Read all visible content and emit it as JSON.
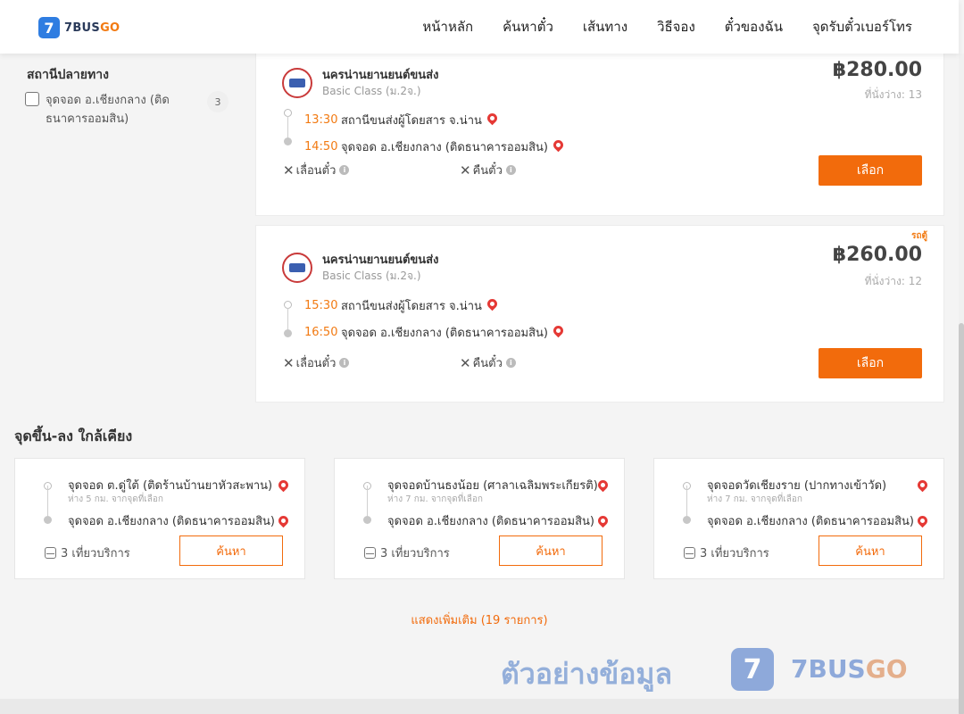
{
  "header": {
    "logo_mark": "7",
    "logo_text_main": "7BUS",
    "logo_text_accent": "GO",
    "nav": [
      "หน้าหลัก",
      "ค้นหาตั๋ว",
      "เส้นทาง",
      "วิธีจอง",
      "ตั๋วของฉัน",
      "จุดรับตั๋วเบอร์โทร"
    ]
  },
  "filter": {
    "title": "สถานีปลายทาง",
    "options": [
      {
        "label": "จุดจอด อ.เชียงกลาง (ติดธนาคารออมสิน)",
        "count": "3",
        "checked": false
      }
    ]
  },
  "trips": [
    {
      "operator": "นครน่านยานยนต์ขนส่ง",
      "class": "Basic Class (ม.2จ.)",
      "price": "฿280.00",
      "seats": "ที่นั่งว่าง: 13",
      "tag": "",
      "depart_time": "13:30",
      "depart_stop": "สถานีขนส่งผู้โดยสาร จ.น่าน",
      "arrive_time": "14:50",
      "arrive_stop": "จุดจอด อ.เชียงกลาง (ติดธนาคารออมสิน)",
      "policy_change": "เลื่อนตั๋ว",
      "policy_refund": "คืนตั๋ว",
      "select_label": "เลือก"
    },
    {
      "operator": "นครน่านยานยนต์ขนส่ง",
      "class": "Basic Class (ม.2จ.)",
      "price": "฿260.00",
      "seats": "ที่นั่งว่าง: 12",
      "tag": "รถตู้",
      "depart_time": "15:30",
      "depart_stop": "สถานีขนส่งผู้โดยสาร จ.น่าน",
      "arrive_time": "16:50",
      "arrive_stop": "จุดจอด อ.เชียงกลาง (ติดธนาคารออมสิน)",
      "policy_change": "เลื่อนตั๋ว",
      "policy_refund": "คืนตั๋ว",
      "select_label": "เลือก"
    }
  ],
  "nearby": {
    "title": "จุดขึ้น-ลง ใกล้เคียง",
    "cards": [
      {
        "from": "จุดจอด ต.ดู่ใต้ (ติดร้านบ้านยาหัวสะพาน)",
        "distance": "ห่าง 5 กม. จากจุดที่เลือก",
        "to": "จุดจอด อ.เชียงกลาง (ติดธนาคารออมสิน)",
        "trips": "3 เที่ยวบริการ",
        "button": "ค้นหา"
      },
      {
        "from": "จุดจอดบ้านธงน้อย (ศาลาเฉลิมพระเกียรติ)",
        "distance": "ห่าง 7 กม. จากจุดที่เลือก",
        "to": "จุดจอด อ.เชียงกลาง (ติดธนาคารออมสิน)",
        "trips": "3 เที่ยวบริการ",
        "button": "ค้นหา"
      },
      {
        "from": "จุดจอดวัดเชียงราย (ปากทางเข้าวัด)",
        "distance": "ห่าง 7 กม. จากจุดที่เลือก",
        "to": "จุดจอด อ.เชียงกลาง (ติดธนาคารออมสิน)",
        "trips": "3 เที่ยวบริการ",
        "button": "ค้นหา"
      }
    ],
    "show_more": "แสดงเพิ่มเติม (19 รายการ)"
  },
  "watermark": {
    "text": "ตัวอย่างข้อมูล",
    "logo_mark": "7",
    "brand_main": "7BUS",
    "brand_accent": "GO"
  },
  "colors": {
    "accent": "#f26b0c",
    "brand_blue": "#2f7de1",
    "pin": "#e53935"
  }
}
